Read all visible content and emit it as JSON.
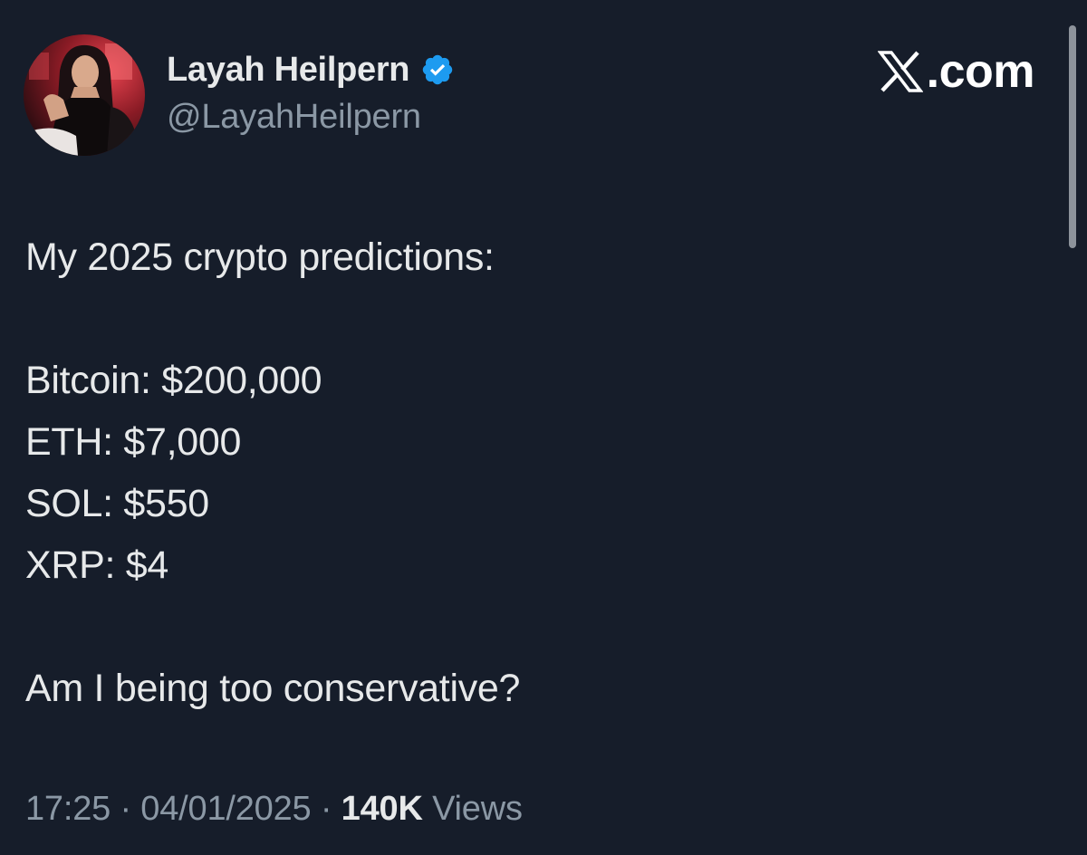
{
  "author": {
    "display_name": "Layah Heilpern",
    "handle": "@LayahHeilpern",
    "verified": true,
    "verified_color": "#1d9bf0"
  },
  "brand": {
    "text": ".com",
    "icon": "x-logo-icon"
  },
  "tweet": {
    "intro": "My 2025 crypto predictions:",
    "predictions": [
      "Bitcoin: $200,000",
      "ETH: $7,000",
      "SOL: $550",
      "XRP: $4"
    ],
    "question": "Am I being too conservative?"
  },
  "meta": {
    "time": "17:25",
    "date": "04/01/2025",
    "separator": "·",
    "views_count": "140K",
    "views_label": "Views"
  },
  "colors": {
    "background": "#161d2a",
    "text": "#e7e9ea",
    "secondary_text": "#8b98a5"
  }
}
